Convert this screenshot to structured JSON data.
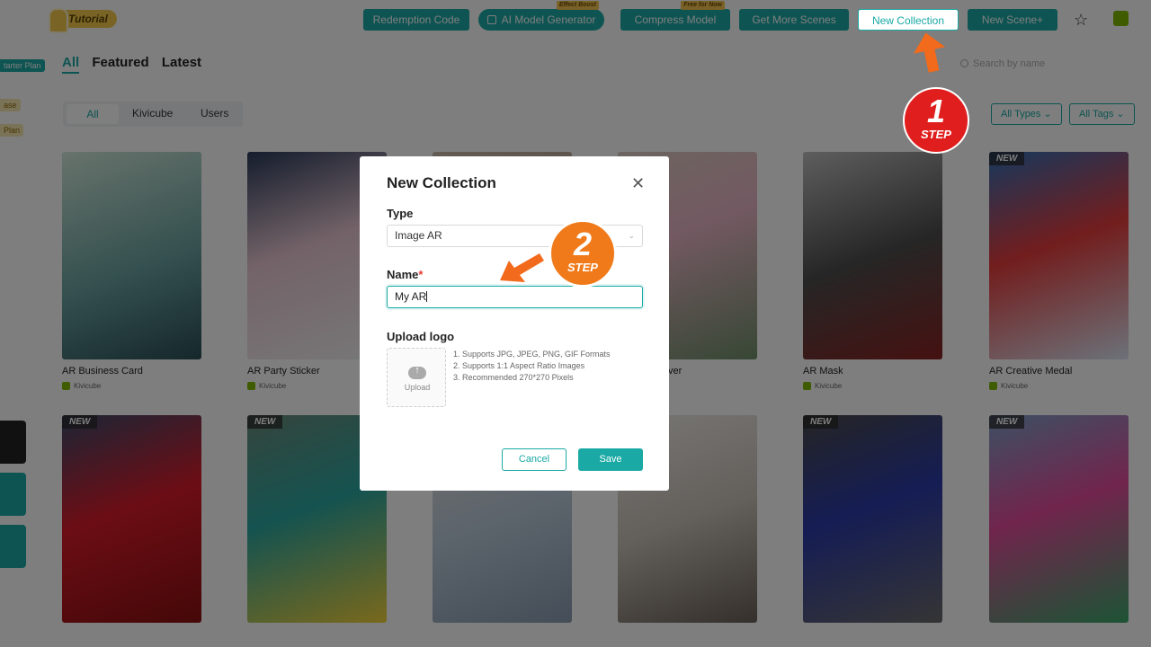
{
  "header": {
    "tutorial_label": "Tutorial",
    "buttons": {
      "redemption": "Redemption Code",
      "ai_model": "AI Model Generator",
      "ai_model_tag": "Effect Boost",
      "compress": "Compress Model",
      "compress_tag": "Free for Now",
      "more_scenes": "Get More Scenes",
      "new_collection": "New Collection",
      "new_scene": "New Scene+"
    }
  },
  "sidebar": {
    "plan_badge": "tarter Plan",
    "badge2": "ase",
    "badge3": "Plan"
  },
  "content_tabs": [
    "All",
    "Featured",
    "Latest"
  ],
  "search": {
    "placeholder": "Search by name"
  },
  "segment": [
    "All",
    "Kivicube",
    "Users"
  ],
  "filters": {
    "types": "All Types",
    "tags": "All Tags"
  },
  "cards": [
    {
      "title": "AR Business Card",
      "by": "Kivicube"
    },
    {
      "title": "AR Party Sticker",
      "by": "Kivicube"
    },
    {
      "title": "ver",
      "by": ""
    },
    {
      "title": "AR Mask",
      "by": "Kivicube"
    },
    {
      "title": "AR Creative Medal",
      "by": "Kivicube"
    }
  ],
  "new_badge": "NEW",
  "steps": {
    "one": {
      "number": "1",
      "word": "STEP"
    },
    "two": {
      "number": "2",
      "word": "STEP"
    }
  },
  "modal": {
    "title": "New Collection",
    "type_label": "Type",
    "type_value": "Image AR",
    "name_label": "Name",
    "name_required": "*",
    "name_value": "My AR",
    "upload_label": "Upload logo",
    "upload_button": "Upload",
    "hints": [
      "1. Supports JPG, JPEG, PNG, GIF Formats",
      "2. Supports 1:1 Aspect Ratio Images",
      "3. Recommended 270*270 Pixels"
    ],
    "cancel": "Cancel",
    "save": "Save"
  },
  "colors": {
    "accent": "#1aa9a4",
    "step1": "#e01e1e",
    "step2": "#f07a1a",
    "arrow": "#f26a1b"
  }
}
